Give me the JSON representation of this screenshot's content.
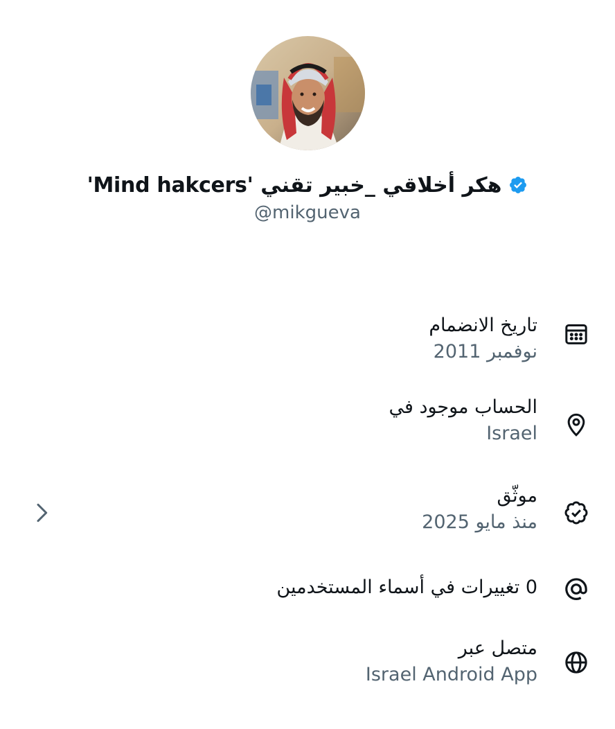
{
  "profile": {
    "display_name": "هكر أخلاقي _خبير تقني 'Mind hakcers' ",
    "handle": "@mikgueva",
    "avatar_icon": "profile-avatar-man-in-shemagh",
    "verified": true,
    "verified_color": "#1d9bf0"
  },
  "about": {
    "items": [
      {
        "icon": "calendar-icon",
        "label": "تاريخ الانضمام",
        "value": "نوفمبر 2011"
      },
      {
        "icon": "location-pin-icon",
        "label": "الحساب موجود في",
        "value": "Israel"
      },
      {
        "icon": "verified-badge-icon",
        "label": "موثّق",
        "value": "منذ مايو 2025"
      },
      {
        "icon": "at-sign-icon",
        "label": "0 تغييرات في أسماء المستخدمين",
        "value": ""
      },
      {
        "icon": "globe-icon",
        "label": "متصل عبر",
        "value": "Israel Android App"
      }
    ]
  },
  "colors": {
    "text": "#0f1419",
    "muted": "#536471"
  }
}
